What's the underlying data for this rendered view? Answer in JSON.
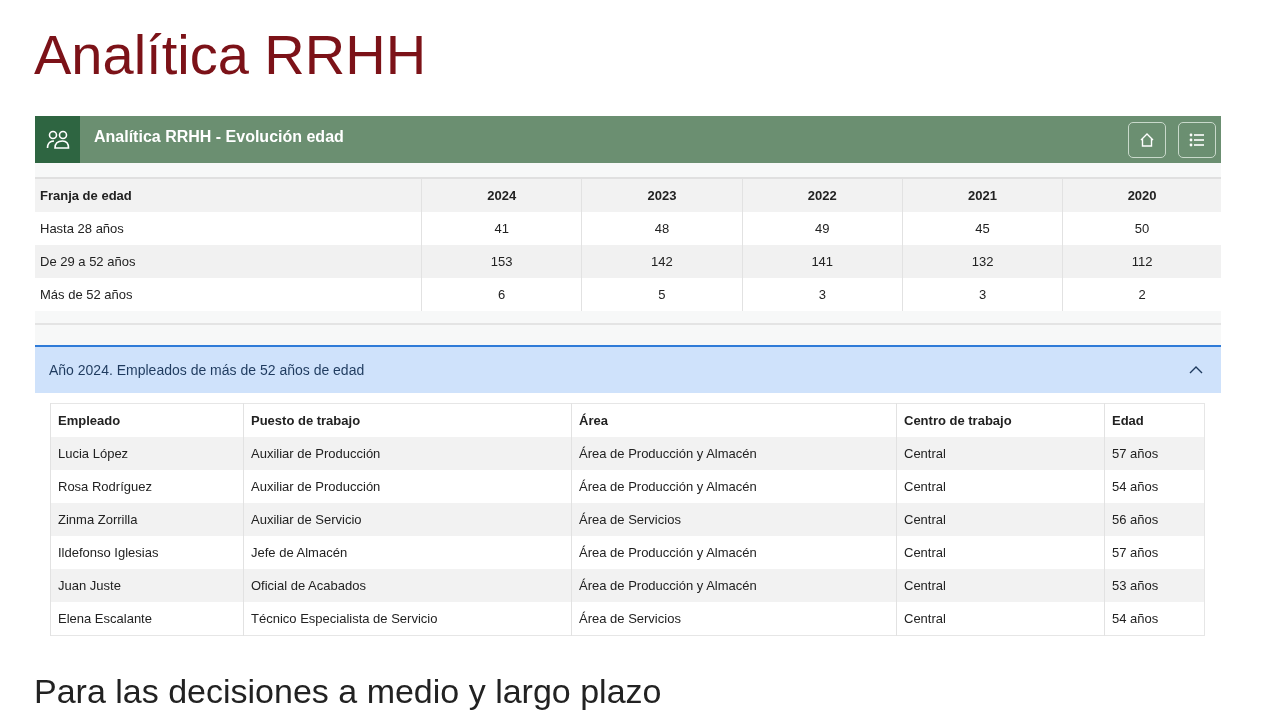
{
  "slide_title": "Analítica RRHH",
  "panel": {
    "title": "Analítica RRHH - Evolución edad"
  },
  "summary_table": {
    "columns": [
      "Franja de edad",
      "2024",
      "2023",
      "2022",
      "2021",
      "2020"
    ],
    "rows": [
      [
        "Hasta 28 años",
        "41",
        "48",
        "49",
        "45",
        "50"
      ],
      [
        "De 29 a 52 años",
        "153",
        "142",
        "141",
        "132",
        "112"
      ],
      [
        "Más de 52 años",
        "6",
        "5",
        "3",
        "3",
        "2"
      ]
    ]
  },
  "accordion": {
    "title": "Año 2024. Empleados de más de 52 años de edad",
    "expanded": true,
    "columns": [
      "Empleado",
      "Puesto de trabajo",
      "Área",
      "Centro de trabajo",
      "Edad"
    ],
    "rows": [
      [
        "Lucia López",
        "Auxiliar de Producción",
        "Área de Producción y Almacén",
        "Central",
        "57 años"
      ],
      [
        "Rosa Rodríguez",
        "Auxiliar de Producción",
        "Área de Producción y Almacén",
        "Central",
        "54 años"
      ],
      [
        "Zinma Zorrilla",
        "Auxiliar de Servicio",
        "Área de Servicios",
        "Central",
        "56 años"
      ],
      [
        "Ildefonso Iglesias",
        "Jefe de Almacén",
        "Área de Producción y Almacén",
        "Central",
        "57 años"
      ],
      [
        "Juan Juste",
        "Oficial de Acabados",
        "Área de Producción y Almacén",
        "Central",
        "53 años"
      ],
      [
        "Elena Escalante",
        "Técnico Especialista de Servicio",
        "Área de Servicios",
        "Central",
        "54 años"
      ]
    ]
  },
  "slide_subtitle": "Para las decisiones a medio y largo plazo"
}
